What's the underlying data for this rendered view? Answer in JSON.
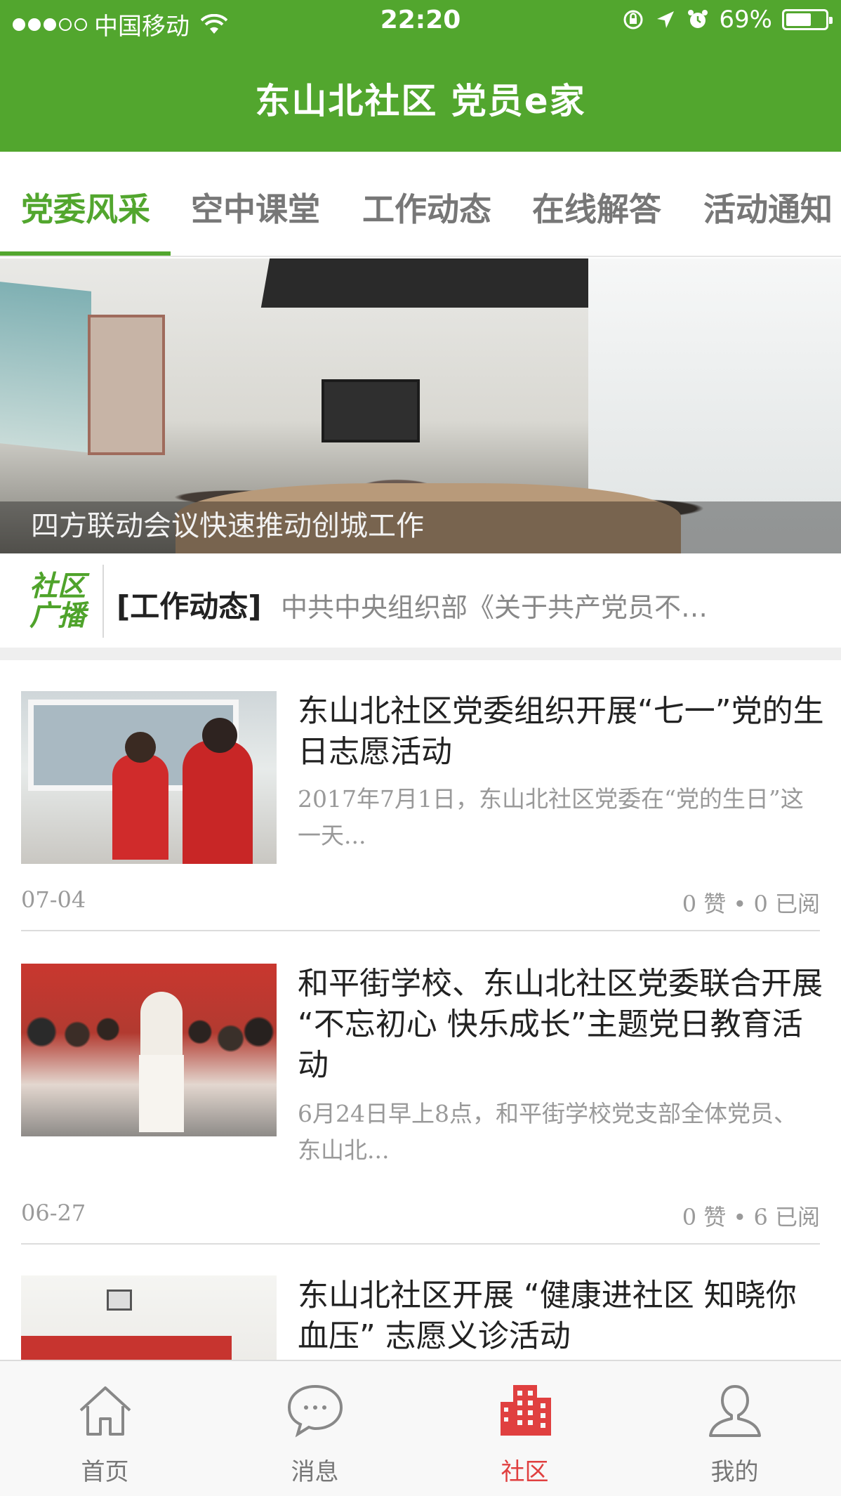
{
  "status_bar": {
    "carrier": "中国移动",
    "time": "22:20",
    "battery": "69%",
    "battery_level": 0.69,
    "signal_bars_on": 3,
    "signal_bars_total": 5
  },
  "header": {
    "title": "东山北社区  党员e家",
    "background_color": "#52a62e"
  },
  "tabs": [
    {
      "label": "党委风采",
      "active": true
    },
    {
      "label": "空中课堂",
      "active": false
    },
    {
      "label": "工作动态",
      "active": false
    },
    {
      "label": "在线解答",
      "active": false
    },
    {
      "label": "活动通知",
      "active": false
    }
  ],
  "banner": {
    "caption": "四方联动会议快速推动创城工作"
  },
  "broadcast": {
    "logo_line1": "社区",
    "logo_line2": "广播",
    "tag": "[工作动态]",
    "text": "中共中央组织部《关于共产党员不…"
  },
  "news": [
    {
      "title": "东山北社区党委组织开展“七一”党的生日志愿活动",
      "summary": "2017年7月1日，东山北社区党委在“党的生日”这一天...",
      "date": "07-04",
      "stats": "0 赞 • 0 已阅"
    },
    {
      "title": "和平街学校、东山北社区党委联合开展 “不忘初心 快乐成长”主题党日教育活动",
      "summary": "6月24日早上8点，和平街学校党支部全体党员、东山北...",
      "date": "06-27",
      "stats": "0 赞 • 6 已阅"
    },
    {
      "title": "东山北社区开展 “健康进社区 知晓你血压” 志愿义诊活动"
    }
  ],
  "tabbar": [
    {
      "label": "首页",
      "icon": "home-icon",
      "active": false
    },
    {
      "label": "消息",
      "icon": "message-icon",
      "active": false
    },
    {
      "label": "社区",
      "icon": "community-building-icon",
      "active": true
    },
    {
      "label": "我的",
      "icon": "user-icon",
      "active": false
    }
  ],
  "colors": {
    "accent_green": "#52a62e",
    "active_red": "#e04040",
    "muted_text": "#9a9a9a"
  }
}
